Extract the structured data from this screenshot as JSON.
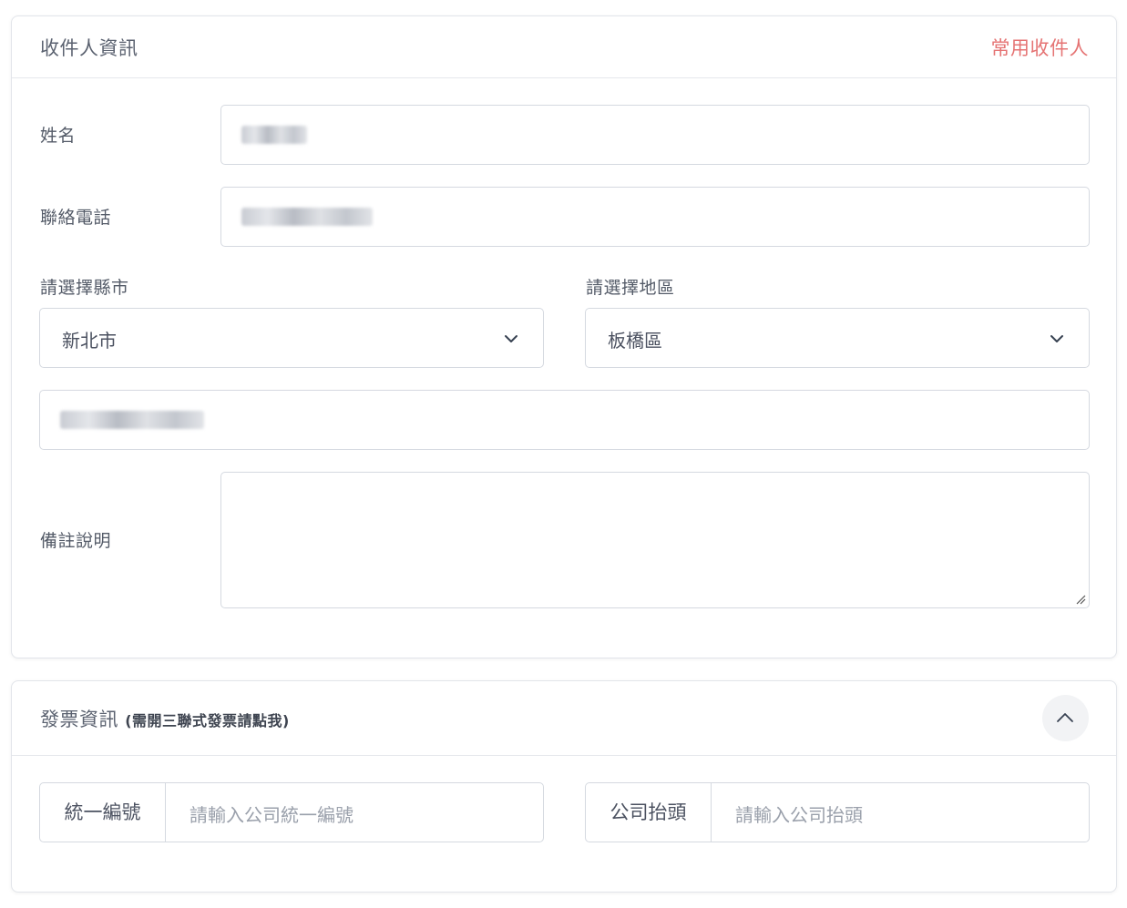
{
  "recipient": {
    "title": "收件人資訊",
    "common_link": "常用收件人",
    "name_label": "姓名",
    "phone_label": "聯絡電話",
    "city_label": "請選擇縣市",
    "city_value": "新北市",
    "district_label": "請選擇地區",
    "district_value": "板橋區",
    "note_label": "備註說明",
    "note_value": ""
  },
  "invoice": {
    "title": "發票資訊",
    "subtitle": "(需開三聯式發票請點我)",
    "tax_id_label": "統一編號",
    "tax_id_placeholder": "請輸入公司統一編號",
    "company_label": "公司抬頭",
    "company_placeholder": "請輸入公司抬頭"
  },
  "icons": {
    "select": "chevron-down-icon",
    "collapse": "chevron-up-icon",
    "resize": "resize-grip-icon"
  },
  "colors": {
    "accent_link": "#e57373",
    "border": "#d5d9e0",
    "text": "#4b5160",
    "placeholder": "#9aa0ab"
  }
}
